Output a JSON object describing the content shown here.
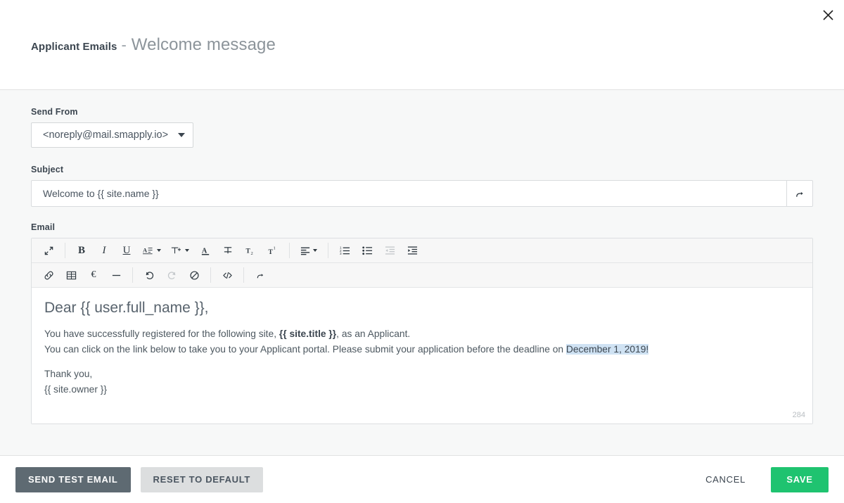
{
  "header": {
    "title_strong": "Applicant Emails",
    "title_separator": "-",
    "title_light": "Welcome message",
    "close_icon": "close-icon"
  },
  "form": {
    "send_from": {
      "label": "Send From",
      "value": "<noreply@mail.smapply.io>",
      "options": [
        "<noreply@mail.smapply.io>"
      ]
    },
    "subject": {
      "label": "Subject",
      "value": "Welcome to {{ site.name }}",
      "placeholder": "Subject",
      "merge_button_icon": "merge-field-icon"
    },
    "email": {
      "label": "Email",
      "char_count": "284",
      "greeting": "Dear {{ user.full_name }},",
      "line1_pre": "You have successfully registered for the following site, ",
      "line1_bold": "{{ site.title }}",
      "line1_post": ", as an Applicant.",
      "line2_pre": "You can click on the link below to take you to your Applicant portal. Please submit your application before the deadline on ",
      "line2_highlight": "December 1, 2019!",
      "closing": "Thank you,",
      "signature": "{{ site.owner }}"
    }
  },
  "toolbar": {
    "row1": [
      {
        "name": "fullscreen-icon",
        "label": "",
        "type": "icon",
        "disabled": false
      },
      {
        "name": "separator",
        "type": "sep"
      },
      {
        "name": "bold-icon",
        "label": "B",
        "type": "text-bold",
        "disabled": false
      },
      {
        "name": "italic-icon",
        "label": "I",
        "type": "text-italic",
        "disabled": false
      },
      {
        "name": "underline-icon",
        "label": "U",
        "type": "text-underline",
        "disabled": false
      },
      {
        "name": "font-family-icon",
        "label": "",
        "type": "icon-caret",
        "disabled": false
      },
      {
        "name": "font-size-icon",
        "label": "",
        "type": "icon-caret",
        "disabled": false
      },
      {
        "name": "text-color-icon",
        "label": "A",
        "type": "text-color",
        "disabled": false
      },
      {
        "name": "strikethrough-icon",
        "label": "",
        "type": "icon",
        "disabled": false
      },
      {
        "name": "subscript-icon",
        "label": "",
        "type": "icon",
        "disabled": false
      },
      {
        "name": "superscript-icon",
        "label": "",
        "type": "icon",
        "disabled": false
      },
      {
        "name": "separator",
        "type": "sep"
      },
      {
        "name": "align-icon",
        "label": "",
        "type": "icon-caret",
        "disabled": false
      },
      {
        "name": "separator",
        "type": "sep"
      },
      {
        "name": "ordered-list-icon",
        "label": "",
        "type": "icon",
        "disabled": false
      },
      {
        "name": "unordered-list-icon",
        "label": "",
        "type": "icon",
        "disabled": false
      },
      {
        "name": "outdent-icon",
        "label": "",
        "type": "icon",
        "disabled": true
      },
      {
        "name": "indent-icon",
        "label": "",
        "type": "icon",
        "disabled": false
      }
    ],
    "row2": [
      {
        "name": "link-icon",
        "label": "",
        "type": "icon",
        "disabled": false
      },
      {
        "name": "table-icon",
        "label": "",
        "type": "icon",
        "disabled": false
      },
      {
        "name": "special-character-icon",
        "label": "€",
        "type": "text",
        "disabled": false
      },
      {
        "name": "horizontal-rule-icon",
        "label": "",
        "type": "icon",
        "disabled": false
      },
      {
        "name": "separator",
        "type": "sep"
      },
      {
        "name": "undo-icon",
        "label": "",
        "type": "icon",
        "disabled": false
      },
      {
        "name": "redo-icon",
        "label": "",
        "type": "icon",
        "disabled": true
      },
      {
        "name": "clear-formatting-icon",
        "label": "",
        "type": "icon",
        "disabled": false
      },
      {
        "name": "separator",
        "type": "sep"
      },
      {
        "name": "code-view-icon",
        "label": "",
        "type": "icon",
        "disabled": false
      },
      {
        "name": "separator",
        "type": "sep"
      },
      {
        "name": "merge-field-icon",
        "label": "",
        "type": "icon",
        "disabled": false
      }
    ]
  },
  "footer": {
    "send_test_email": "SEND TEST EMAIL",
    "reset_to_default": "RESET TO DEFAULT",
    "cancel": "CANCEL",
    "save": "SAVE"
  },
  "colors": {
    "save_green": "#1fc370",
    "dark_button": "#5e6a72",
    "grey_button": "#dcdedf",
    "body_background": "#f7f8f8",
    "selection_highlight": "#cfe2f3"
  }
}
